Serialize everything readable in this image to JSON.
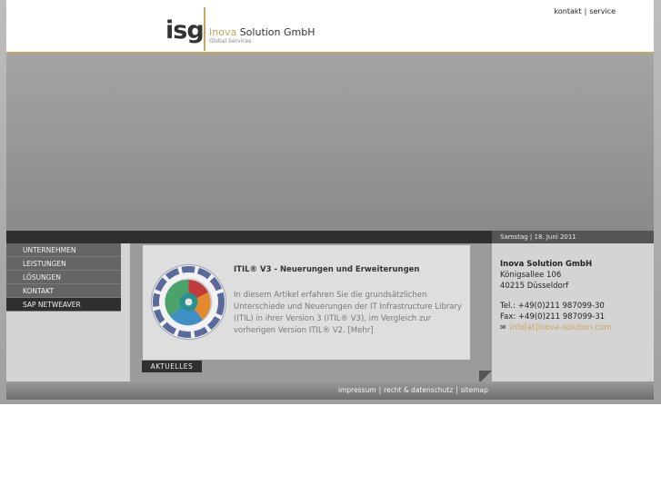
{
  "header": {
    "logo": {
      "mark": "isg",
      "brand_accent": "Inova",
      "brand_rest": " Solution GmbH",
      "subtitle": "Global Services"
    },
    "topnav": [
      {
        "label": "kontakt"
      },
      {
        "label": "service"
      }
    ],
    "topnav_separator": "|"
  },
  "date": "Samstag | 18. Juni 2011",
  "nav": {
    "items": [
      {
        "label": "UNTERNEHMEN",
        "active": false
      },
      {
        "label": "LEISTUNGEN",
        "active": false
      },
      {
        "label": "LÖSUNGEN",
        "active": false
      },
      {
        "label": "KONTAKT",
        "active": false
      },
      {
        "label": "SAP NETWEAVER",
        "active": true
      }
    ]
  },
  "article": {
    "image_icon": "itil-lifecycle-diagram-icon",
    "title": "ITIL® V3 - Neuerungen und Erweiterungen",
    "body": "In diesem Artikel erfahren Sie die grundsätzlichen Unterschiede und Neuerungen der IT Infrastructure Library (ITIL) in ihrer Version 3 (ITIL® V3), im Vergleich zur vorherigen Version ITIL® V2. [Mehr]"
  },
  "aktuelles_label": "AKTUELLES",
  "contact": {
    "company": "Inova Solution GmbH",
    "street": "Königsallee 106",
    "city": "40215 Düsseldorf",
    "phone": "Tel.: +49(0)211 987099-30",
    "fax": "Fax: +49(0)211 987099-31",
    "email_icon": "envelope-icon",
    "email": "info[at]inova-solution.com"
  },
  "footer": {
    "links": [
      {
        "label": "impressum"
      },
      {
        "label": "recht & datenschutz"
      },
      {
        "label": "sitemap"
      }
    ],
    "separator": "|"
  },
  "colors": {
    "accent": "#c9a55d",
    "dark": "#2f2f2f",
    "content_bg": "#d4d4d4"
  }
}
